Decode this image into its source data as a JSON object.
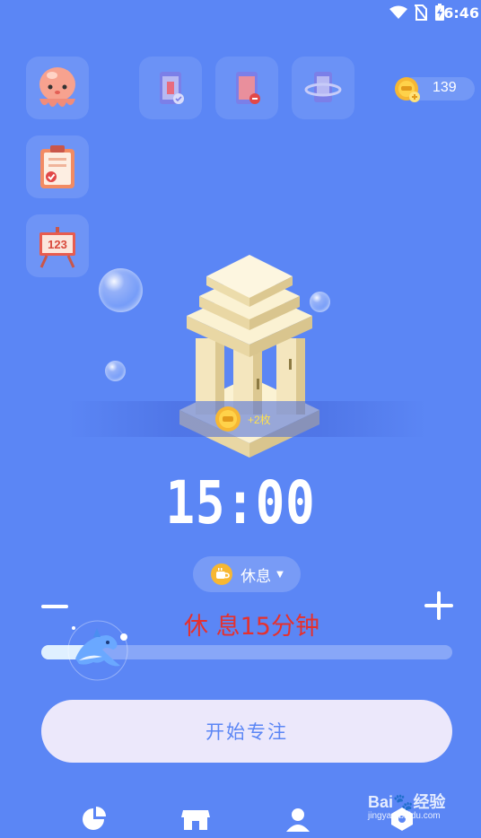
{
  "status_bar": {
    "time": "6:46",
    "icons": [
      "wifi-icon",
      "no-sim-icon",
      "battery-charging-icon"
    ]
  },
  "side_buttons": [
    {
      "name": "octopus-avatar-icon"
    },
    {
      "name": "clipboard-checklist-icon"
    },
    {
      "name": "easel-123-icon"
    }
  ],
  "mode_buttons": [
    {
      "name": "phone-check-mode-icon"
    },
    {
      "name": "phone-minus-mode-icon"
    },
    {
      "name": "phone-ring-mode-icon"
    }
  ],
  "coins": {
    "count": "139",
    "icon": "coin-plus-icon"
  },
  "reward": {
    "text": "+2枚",
    "icon": "coin-icon"
  },
  "timer": {
    "value": "15:00"
  },
  "mode_select": {
    "label": "休息",
    "icon": "coffee-cup-icon"
  },
  "rest_text": "休 息15分钟",
  "slider": {
    "level": 0.13,
    "thumb_icon": "dolphin-icon"
  },
  "start_button": {
    "label": "开始专注"
  },
  "bottom_nav": [
    {
      "name": "nav-stats",
      "icon": "pie-chart-icon"
    },
    {
      "name": "nav-shop",
      "icon": "store-icon"
    },
    {
      "name": "nav-profile",
      "icon": "person-icon"
    },
    {
      "name": "nav-more",
      "icon": "hexagon-icon"
    }
  ],
  "watermark": {
    "brand": "Bai",
    "brand_suffix": "经验",
    "url": "jingyan.baidu.com"
  },
  "colors": {
    "background": "#5b86f5",
    "rest_text": "#e5312e",
    "start_button_bg": "#ece8fb",
    "reward_text": "#ffe14d"
  }
}
